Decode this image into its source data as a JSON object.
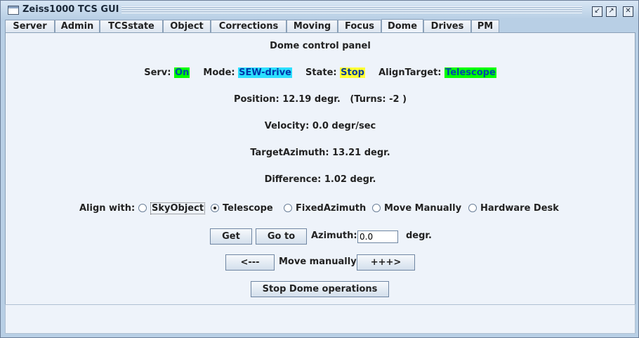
{
  "window": {
    "title": "Zeiss1000 TCS GUI"
  },
  "tabs": [
    {
      "label": "Server"
    },
    {
      "label": "Admin"
    },
    {
      "label": "TCSstate"
    },
    {
      "label": "Object"
    },
    {
      "label": "Corrections"
    },
    {
      "label": "Moving"
    },
    {
      "label": "Focus"
    },
    {
      "label": "Dome"
    },
    {
      "label": "Drives"
    },
    {
      "label": "PM"
    }
  ],
  "panel": {
    "heading": "Dome control panel",
    "status": {
      "serv_label": "Serv:",
      "serv_value": "On",
      "mode_label": "Mode:",
      "mode_value": "SEW-drive",
      "state_label": "State:",
      "state_value": "Stop",
      "align_label": "AlignTarget:",
      "align_value": "Telescope"
    },
    "position": "Position: 12.19 degr.   (Turns: -2 )",
    "velocity": "Velocity: 0.0 degr/sec",
    "target_azimuth": "TargetAzimuth: 13.21 degr.",
    "difference": "Difference: 1.02 degr.",
    "align_with_label": "Align with:",
    "align_options": [
      {
        "label": "SkyObject",
        "selected": false
      },
      {
        "label": "Telescope",
        "selected": true
      },
      {
        "label": "FixedAzimuth",
        "selected": false
      },
      {
        "label": "Move Manually",
        "selected": false
      },
      {
        "label": "Hardware Desk",
        "selected": false
      }
    ],
    "get_label": "Get",
    "goto_label": "Go to",
    "azimuth_label": "Azimuth:",
    "azimuth_value": "0.0",
    "degr_label": "degr.",
    "left_label": "<---",
    "move_manually_label": "Move manually",
    "right_label": "+++>",
    "stop_label": "Stop Dome operations"
  },
  "colors": {
    "on": "#00ff00",
    "mode": "#2ce0ff",
    "state": "#ffff33",
    "align": "#00ff00"
  }
}
